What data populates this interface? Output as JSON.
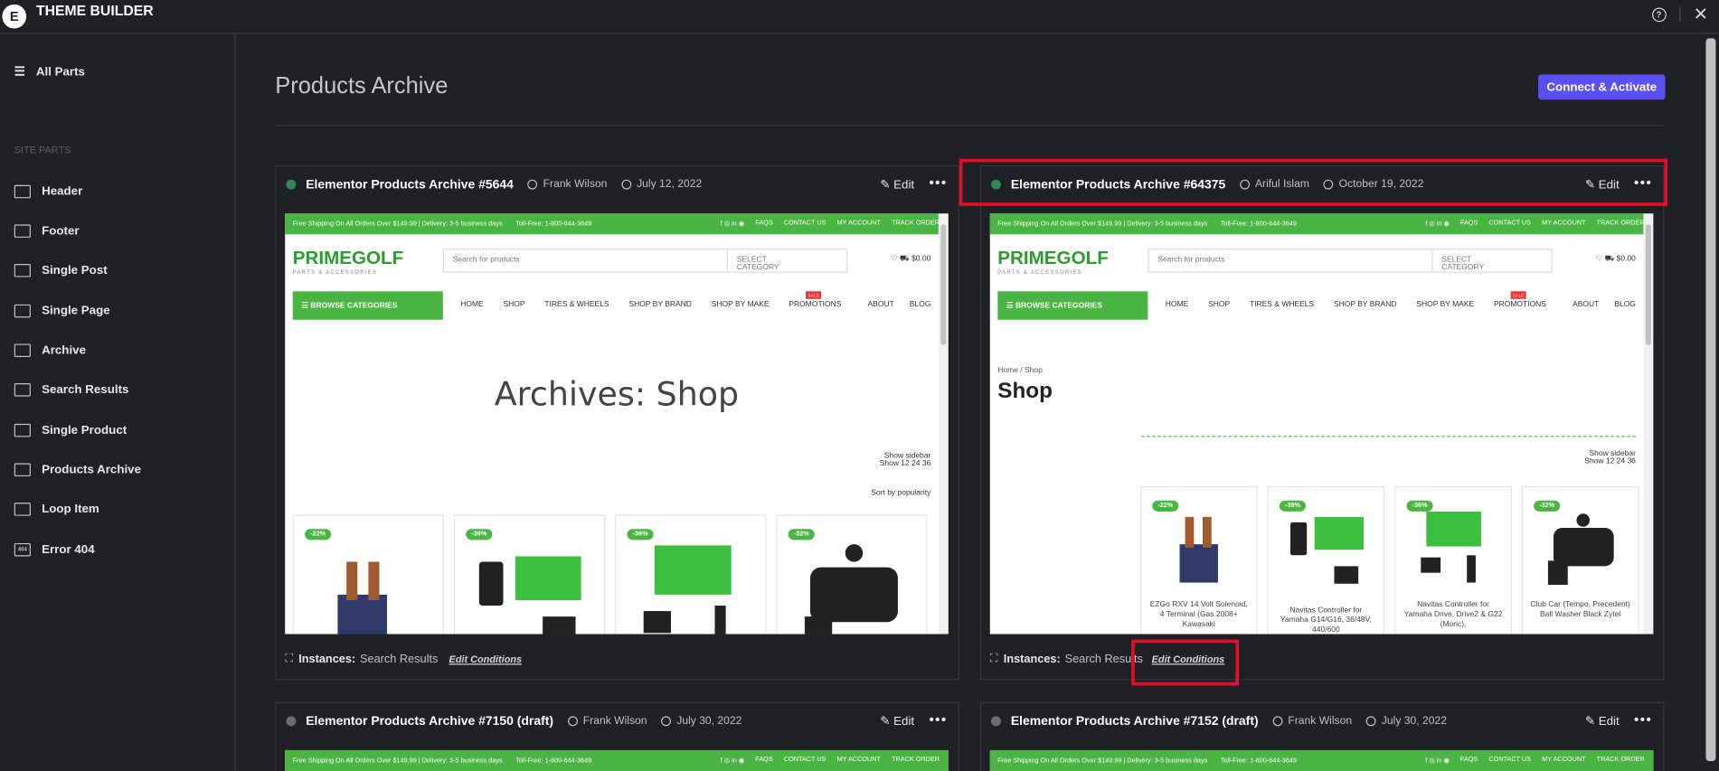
{
  "app": {
    "title": "THEME BUILDER",
    "logo": "E"
  },
  "sidebar": {
    "all_parts": "All Parts",
    "section_label": "SITE PARTS",
    "items": [
      "Header",
      "Footer",
      "Single Post",
      "Single Page",
      "Archive",
      "Search Results",
      "Single Product",
      "Products Archive",
      "Loop Item",
      "Error 404"
    ]
  },
  "main": {
    "title": "Products Archive",
    "cta": "Connect & Activate"
  },
  "cards": [
    {
      "name": "Elementor Products Archive #5644",
      "author": "Frank Wilson",
      "date": "July 12, 2022",
      "edit": "Edit",
      "instances_label": "Instances:",
      "instances_value": "Search Results",
      "edit_conditions": "Edit Conditions",
      "status_color": "#2e8b57"
    },
    {
      "name": "Elementor Products Archive #64375",
      "author": "Ariful Islam",
      "date": "October 19, 2022",
      "edit": "Edit",
      "instances_label": "Instances:",
      "instances_value": "Search Results",
      "edit_conditions": "Edit Conditions",
      "status_color": "#2e8b57"
    },
    {
      "name": "Elementor Products Archive #7150 (draft)",
      "author": "Frank Wilson",
      "date": "July 30, 2022",
      "edit": "Edit",
      "status_color": "#6b6f75"
    },
    {
      "name": "Elementor Products Archive #7152 (draft)",
      "author": "Frank Wilson",
      "date": "July 30, 2022",
      "edit": "Edit",
      "status_color": "#6b6f75"
    }
  ],
  "preview": {
    "topbar_left": "Free Shipping On All Orders Over $149.99 | Delivery: 3-5 business days",
    "phone": "Toll-Free: 1-800-644-3649",
    "top_links": [
      "FAQS",
      "CONTACT US",
      "MY ACCOUNT",
      "TRACK ORDER"
    ],
    "logo": "PRIMEGOLF",
    "logo_sub": "PARTS & ACCESSORIES",
    "search_placeholder": "Search for products",
    "select_category": "SELECT CATEGORY",
    "cart_total": "$0.00",
    "browse": "BROWSE CATEGORIES",
    "nav": [
      "HOME",
      "SHOP",
      "TIRES & WHEELS",
      "SHOP BY BRAND",
      "SHOP BY MAKE",
      "PROMOTIONS"
    ],
    "nav_right": [
      "ABOUT",
      "BLOG"
    ],
    "sale": "SALE",
    "archive_title": "Archives: Shop",
    "show_sidebar": "Show sidebar",
    "show_counts": "Show 12 24 36",
    "sort": "Sort by popularity",
    "breadcrumb_home": "Home",
    "breadcrumb_current": "Shop",
    "shop_title": "Shop",
    "badges": [
      "-22%",
      "-39%",
      "-36%",
      "-32%"
    ],
    "product_names": [
      "EZGo RXV 14 Volt Solenoid, 4 Terminal (Gas 2008+ Kawasaki",
      "Navitas Controller for Yamaha G14/G16, 36/48V, 440/600",
      "Navitas Controller for Yamaha Drive, Drive2 & G22 (Moric),",
      "Club Car (Tempo, Precedent) Ball Washer Black Zytel"
    ]
  },
  "colors": {
    "accent": "#5a4ff0",
    "highlight": "#e3102d",
    "brand_green": "#4bb543"
  },
  "icons": [
    "filter-icon",
    "question-icon",
    "close-icon",
    "user-icon",
    "clock-icon",
    "pencil-icon",
    "more-icon",
    "hierarchy-icon"
  ]
}
